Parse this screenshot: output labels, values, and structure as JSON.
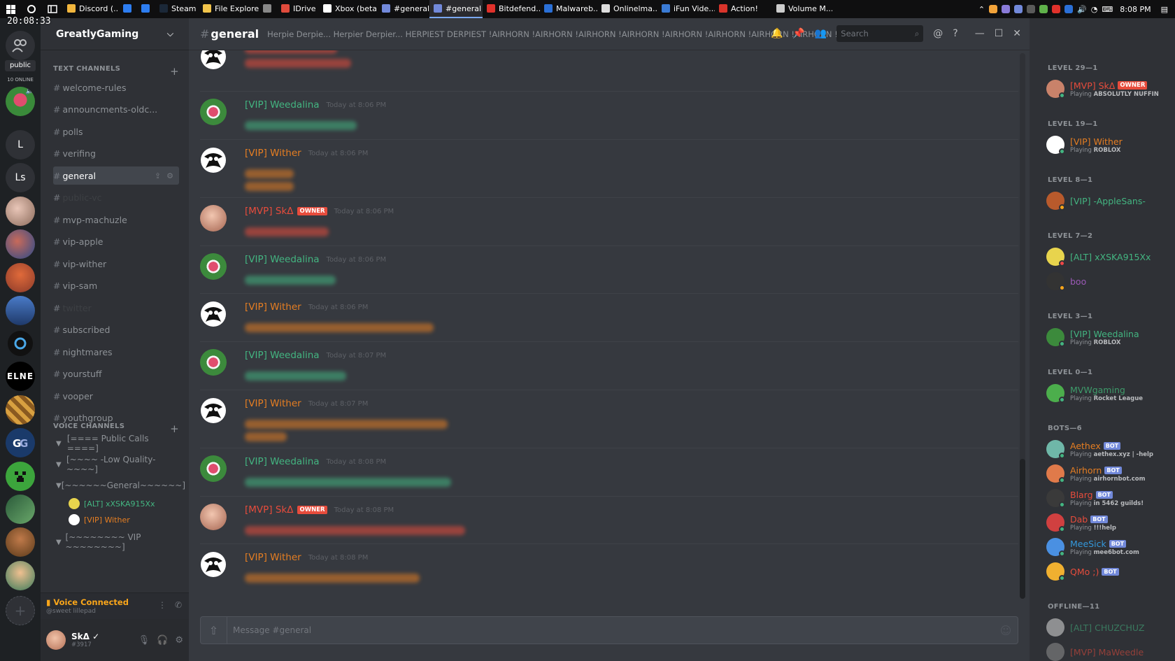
{
  "clock_overlay": "20:08:33",
  "taskbar": {
    "tasks": [
      {
        "label": "Discord (...",
        "color": "#f2b63d",
        "active": false
      },
      {
        "label": "",
        "color": "#2d7df0",
        "active": false
      },
      {
        "label": "",
        "color": "#2d7df0",
        "active": false
      },
      {
        "label": "Steam",
        "color": "#1b2838",
        "active": false
      },
      {
        "label": "File Explorer",
        "color": "#f1c44b",
        "active": false
      },
      {
        "label": "",
        "color": "#888888",
        "active": false
      },
      {
        "label": "IDrive",
        "color": "#e04b3c",
        "active": false
      },
      {
        "label": "Xbox (beta)",
        "color": "#ffffff",
        "active": false
      },
      {
        "label": "#general -...",
        "color": "#7289da",
        "active": false
      },
      {
        "label": "#general -...",
        "color": "#7289da",
        "active": true
      },
      {
        "label": "Bitdefend...",
        "color": "#e0312b",
        "active": false
      },
      {
        "label": "Malwareb...",
        "color": "#2a6fd6",
        "active": false
      },
      {
        "label": "Onlinelma...",
        "color": "#dddddd",
        "active": false
      },
      {
        "label": "iFun Vide...",
        "color": "#3a7bd5",
        "active": false
      },
      {
        "label": "Action!",
        "color": "#d9342b",
        "active": false
      },
      {
        "label": "Volume M...",
        "color": "#cccccc",
        "active": false
      }
    ],
    "time": "8:08 PM"
  },
  "servers": {
    "public_label": "public",
    "online_label": "10 ONLINE",
    "letter_1": "L",
    "letter_2": "Ls",
    "elne": "ELNE"
  },
  "guild": {
    "name": "GreatlyGaming",
    "text_category": "TEXT CHANNELS",
    "text_channels": [
      {
        "name": "welcome-rules",
        "state": "normal"
      },
      {
        "name": "announcments-oldc...",
        "state": "normal"
      },
      {
        "name": "polls",
        "state": "normal"
      },
      {
        "name": "verifing",
        "state": "normal"
      },
      {
        "name": "general",
        "state": "active"
      },
      {
        "name": "public-vc",
        "state": "dim"
      },
      {
        "name": "mvp-machuzle",
        "state": "normal"
      },
      {
        "name": "vip-apple",
        "state": "normal"
      },
      {
        "name": "vip-wither",
        "state": "normal"
      },
      {
        "name": "vip-sam",
        "state": "normal"
      },
      {
        "name": "twitter",
        "state": "dim"
      },
      {
        "name": "subscribed",
        "state": "normal"
      },
      {
        "name": "nightmares",
        "state": "normal"
      },
      {
        "name": "yourstuff",
        "state": "normal"
      },
      {
        "name": "vooper",
        "state": "normal"
      },
      {
        "name": "youthgroup",
        "state": "normal"
      }
    ],
    "voice_category": "VOICE CHANNELS",
    "voice_channels": [
      "[==== Public Calls ====]",
      "[~~~~ -Low Quality- ~~~~]",
      "[~~~~~~General~~~~~~]",
      "[~~~~~~~~ VIP ~~~~~~~~]"
    ],
    "voice_users": [
      {
        "name": "[ALT] xXSKA915Xx",
        "color": "#43b581"
      },
      {
        "name": "[VIP] Wither",
        "color": "#e67e22"
      }
    ],
    "voice_connected": "Voice Connected",
    "voice_sub": "@sweet lillepad",
    "user": {
      "name": "SkΔ ✓",
      "tag": "#3917"
    }
  },
  "chat": {
    "channel": "general",
    "topic": "Herpie Derpie... Herpier Derpier... HERPIEST DERPIEST !AIRHORN !AIRHORN !AIRHORN !AIRHORN !AIRHORN !AIRHORN !AIRHORN !AIRHORN !AIRH...",
    "search_placeholder": "Search",
    "composer_placeholder": "Message #general",
    "messages": [
      {
        "author": "",
        "color": "#e67e22",
        "time": "",
        "avatar": "wither",
        "owner": false
      },
      {
        "author": "[VIP] Weedalina",
        "color": "#43b581",
        "time": "Today at 8:06 PM",
        "avatar": "weed",
        "owner": false
      },
      {
        "author": "[VIP] Wither",
        "color": "#e67e22",
        "time": "Today at 8:06 PM",
        "avatar": "wither",
        "owner": false
      },
      {
        "author": "[MVP] SkΔ",
        "color": "#e74c3c",
        "time": "Today at 8:06 PM",
        "avatar": "mvp",
        "owner": true
      },
      {
        "author": "[VIP] Weedalina",
        "color": "#43b581",
        "time": "Today at 8:06 PM",
        "avatar": "weed",
        "owner": false
      },
      {
        "author": "[VIP] Wither",
        "color": "#e67e22",
        "time": "Today at 8:06 PM",
        "avatar": "wither",
        "owner": false
      },
      {
        "author": "[VIP] Weedalina",
        "color": "#43b581",
        "time": "Today at 8:07 PM",
        "avatar": "weed",
        "owner": false
      },
      {
        "author": "[VIP] Wither",
        "color": "#e67e22",
        "time": "Today at 8:07 PM",
        "avatar": "wither",
        "owner": false
      },
      {
        "author": "[VIP] Weedalina",
        "color": "#43b581",
        "time": "Today at 8:08 PM",
        "avatar": "weed",
        "owner": false
      },
      {
        "author": "[MVP] SkΔ",
        "color": "#e74c3c",
        "time": "Today at 8:08 PM",
        "avatar": "mvp",
        "owner": true
      },
      {
        "author": "[VIP] Wither",
        "color": "#e67e22",
        "time": "Today at 8:08 PM",
        "avatar": "wither",
        "owner": false
      }
    ],
    "owner_badge": "OWNER"
  },
  "members": {
    "bot_badge": "BOT",
    "groups": [
      {
        "role": "LEVEL 29—1",
        "members": [
          {
            "name": "[MVP] SkΔ",
            "color": "#e74c3c",
            "playing": "ABSOLUTLY NUFFIN",
            "owner": true,
            "bot": false,
            "status": "#43b581",
            "avatar": "#c9826a"
          }
        ]
      },
      {
        "role": "LEVEL 19—1",
        "members": [
          {
            "name": "[VIP] Wither",
            "color": "#e67e22",
            "playing": "ROBLOX",
            "owner": false,
            "bot": false,
            "status": "#43b581",
            "avatar": "#ffffff"
          }
        ]
      },
      {
        "role": "LEVEL 8—1",
        "members": [
          {
            "name": "[VIP] -AppleSans-",
            "color": "#43b581",
            "playing": "",
            "owner": false,
            "bot": false,
            "status": "#faa61a",
            "avatar": "#b85a2c"
          }
        ]
      },
      {
        "role": "LEVEL 7—2",
        "members": [
          {
            "name": "[ALT] xXSKA915Xx",
            "color": "#43b581",
            "playing": "",
            "owner": false,
            "bot": false,
            "status": "#f04747",
            "avatar": "#e8d44d"
          },
          {
            "name": "boo",
            "color": "#9b59b6",
            "playing": "",
            "owner": false,
            "bot": false,
            "status": "#faa61a",
            "avatar": "#333333"
          }
        ]
      },
      {
        "role": "LEVEL 3—1",
        "members": [
          {
            "name": "[VIP] Weedalina",
            "color": "#43b581",
            "playing": "ROBLOX",
            "owner": false,
            "bot": false,
            "status": "#43b581",
            "avatar": "#3c8a3c"
          }
        ]
      },
      {
        "role": "LEVEL 0—1",
        "members": [
          {
            "name": "MVWgaming",
            "color": "#3e9c6b",
            "playing": "Rocket League",
            "owner": false,
            "bot": false,
            "status": "#43b581",
            "avatar": "#4cae4c"
          }
        ]
      },
      {
        "role": "BOTS—6",
        "members": [
          {
            "name": "Aethex",
            "color": "#e67e22",
            "playing": "aethex.xyz | -help",
            "owner": false,
            "bot": true,
            "status": "#43b581",
            "avatar": "#6fb7a8"
          },
          {
            "name": "Airhorn",
            "color": "#e67e22",
            "playing": "airhornbot.com",
            "owner": false,
            "bot": true,
            "status": "#43b581",
            "avatar": "#e07a4a"
          },
          {
            "name": "Blarg",
            "color": "#e74c3c",
            "playing": "in 5462 guilds!",
            "owner": false,
            "bot": true,
            "status": "#43b581",
            "avatar": "#3a3a3a"
          },
          {
            "name": "Dab",
            "color": "#e74c3c",
            "playing": "!!!help",
            "owner": false,
            "bot": true,
            "status": "#43b581",
            "avatar": "#d04040"
          },
          {
            "name": "MeeSick",
            "color": "#3498db",
            "playing": "mee6bot.com",
            "owner": false,
            "bot": true,
            "status": "#43b581",
            "avatar": "#4a90e2"
          },
          {
            "name": "QMo ;)",
            "color": "#e74c3c",
            "playing": "",
            "owner": false,
            "bot": true,
            "status": "#43b581",
            "avatar": "#f0b030"
          }
        ]
      },
      {
        "role": "OFFLINE—11",
        "members": [
          {
            "name": "[ALT] CHUZCHUZ",
            "color": "#43b581",
            "playing": "",
            "owner": false,
            "bot": false,
            "status": "",
            "avatar": "#cfcfcf"
          },
          {
            "name": "[MVP] MaWeedle",
            "color": "#e74c3c",
            "playing": "",
            "owner": false,
            "bot": false,
            "status": "",
            "avatar": "#888888"
          }
        ]
      }
    ]
  },
  "colors": {
    "accent": "#7289da",
    "owner": "#e74c3c",
    "vip_orange": "#e67e22",
    "vip_green": "#43b581"
  }
}
